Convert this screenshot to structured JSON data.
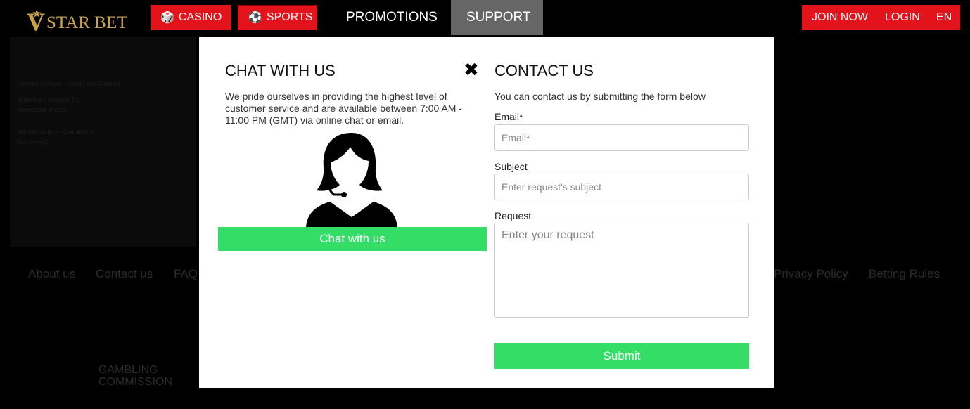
{
  "header": {
    "logo": "STAR BET",
    "logo_letter": "V",
    "casino": "CASINO",
    "sports": "SPORTS",
    "promotions": "PROMOTIONS",
    "support": "SUPPORT",
    "join": "JOIN NOW",
    "login": "LOGIN",
    "lang": "EN",
    "accent": "#e3131b"
  },
  "background": {
    "league": "Premier League - Cards and Corners",
    "matches": [
      "Tottenham Hotspur FC",
      "Newcastle United",
      "Wolverhampton Wanderers",
      "Burnley FC"
    ],
    "footer_links": [
      "About us",
      "Contact us",
      "FAQ",
      "Privacy Policy",
      "Betting Rules"
    ],
    "commission": "GAMBLING COMMISSION"
  },
  "chat": {
    "title": "CHAT WITH US",
    "text": "We pride ourselves in providing the highest level of customer service and are available between 7:00 AM - 11:00 PM (GMT) via online chat or email.",
    "button": "Chat with us"
  },
  "contact": {
    "title": "CONTACT US",
    "intro": "You can contact us by submitting the form below",
    "email_label": "Email*",
    "email_ph": "Email*",
    "subject_label": "Subject",
    "subject_ph": "Enter request's subject",
    "request_label": "Request",
    "request_ph": "Enter your request",
    "submit": "Submit",
    "button_color": "#33dd66"
  }
}
